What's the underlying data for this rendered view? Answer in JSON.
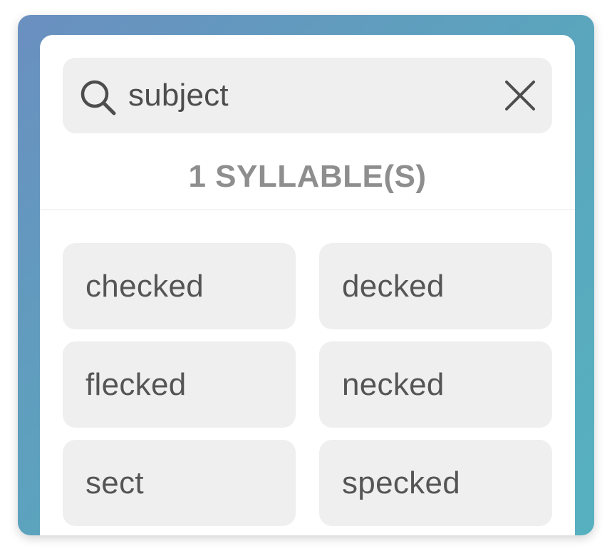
{
  "search": {
    "query": "subject",
    "icon": "search-icon",
    "clear_icon": "close-icon"
  },
  "results": {
    "section_title": "1 SYLLABLE(S)",
    "words": [
      "checked",
      "decked",
      "flecked",
      "necked",
      "sect",
      "specked"
    ]
  },
  "colors": {
    "gradient_start": "#6a8fc0",
    "gradient_end": "#56b1bf",
    "tile_background": "#efefef",
    "text": "#555555",
    "section_title": "#8e8e8e"
  }
}
